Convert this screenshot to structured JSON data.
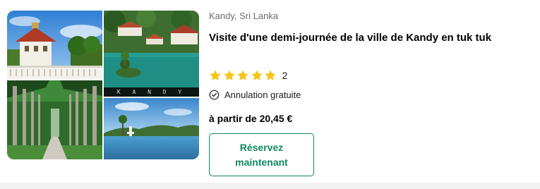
{
  "listing": {
    "location": "Kandy, Sri Lanka",
    "title": "Visite d'une demi-journée de la ville de Kandy en tuk tuk",
    "rating": {
      "stars": 5,
      "max_stars": 5,
      "count": "2",
      "star_color": "#f5c518"
    },
    "cancellation": {
      "icon": "check-circle-icon",
      "text": "Annulation gratuite"
    },
    "price": "à partir de 20,45 €",
    "reserve_button": {
      "label": "Réservez maintenant",
      "color": "#0f8a5f"
    }
  },
  "gallery": {
    "image_caption": "K A N D Y"
  }
}
